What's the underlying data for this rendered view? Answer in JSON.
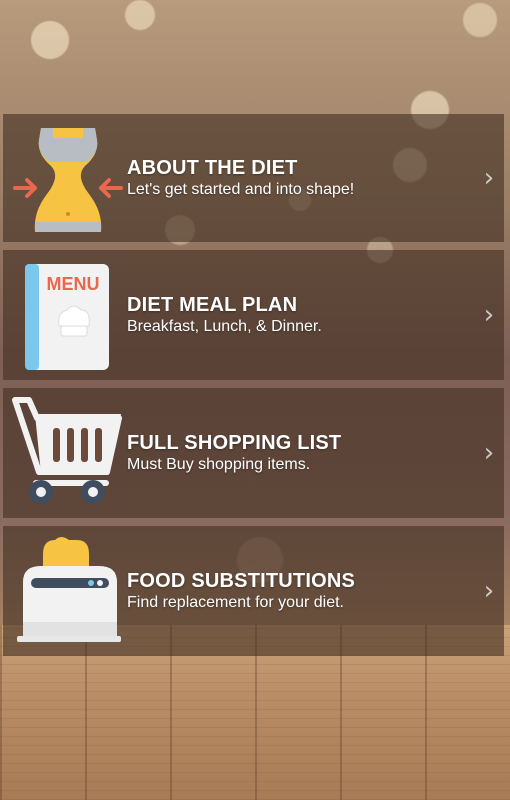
{
  "items": [
    {
      "title": "ABOUT THE DIET",
      "subtitle": "Let's get started and into shape!",
      "icon": "waist-icon"
    },
    {
      "title": "DIET MEAL PLAN",
      "subtitle": "Breakfast, Lunch, & Dinner.",
      "icon": "menu-book-icon",
      "icon_text": "MENU"
    },
    {
      "title": "FULL SHOPPING LIST",
      "subtitle": "Must Buy shopping items.",
      "icon": "shopping-cart-icon"
    },
    {
      "title": "FOOD SUBSTITUTIONS",
      "subtitle": "Find replacement for your diet.",
      "icon": "toaster-icon"
    }
  ],
  "chevron": "›",
  "colors": {
    "card_bg": "#44302488",
    "accent_red": "#e8674f",
    "accent_yellow": "#f6c342"
  }
}
